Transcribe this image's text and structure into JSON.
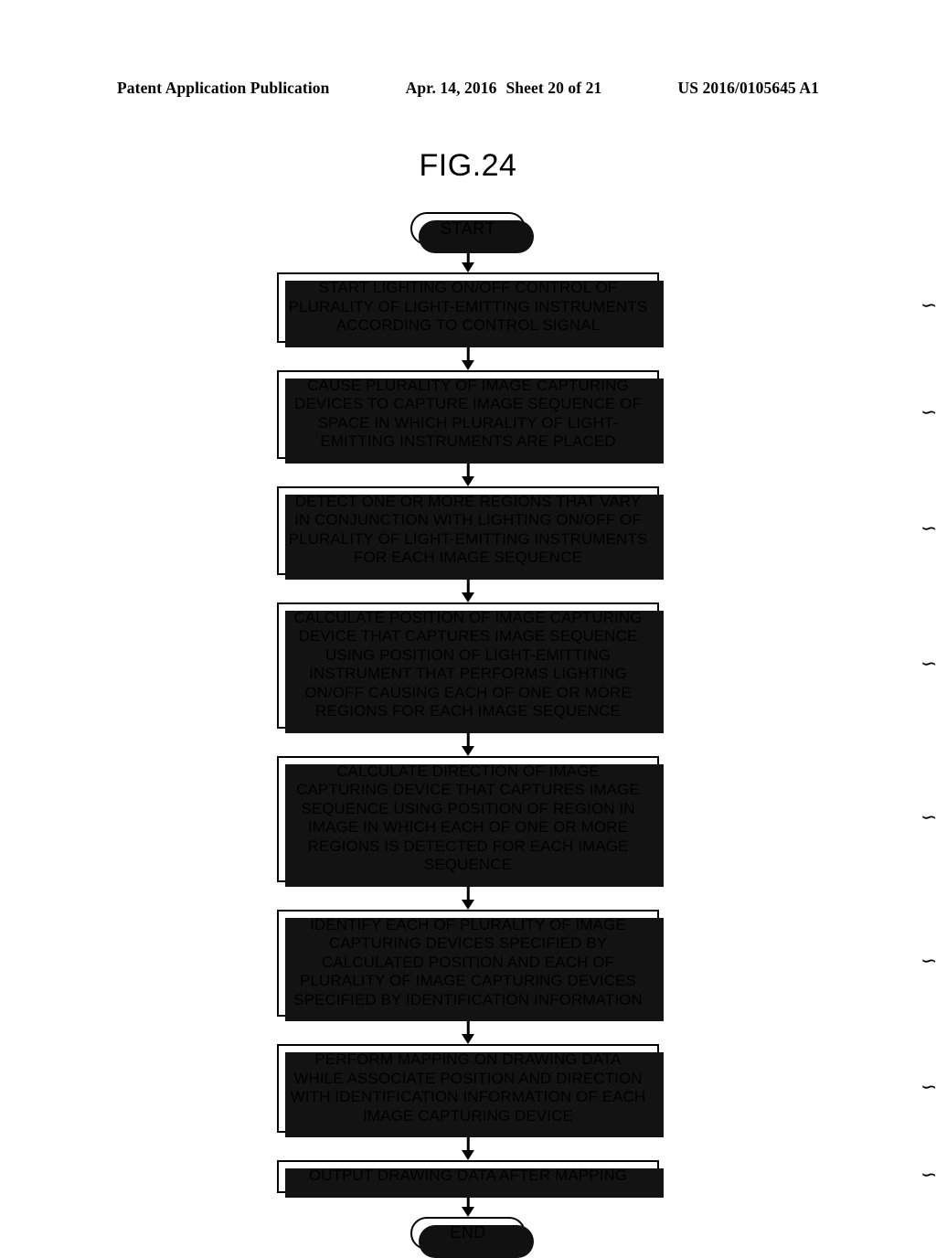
{
  "header": {
    "left": "Patent Application Publication",
    "date": "Apr. 14, 2016",
    "sheet": "Sheet 20 of 21",
    "pubnum": "US 2016/0105645 A1"
  },
  "figure": {
    "title": "FIG.24"
  },
  "flowchart": {
    "start_label": "START",
    "end_label": "END",
    "steps": [
      {
        "id": "S201",
        "lines": [
          "START LIGHTING ON/OFF CONTROL OF",
          "PLURALITY OF LIGHT-EMITTING INSTRUMENTS",
          "ACCORDING TO CONTROL SIGNAL"
        ]
      },
      {
        "id": "S203",
        "lines": [
          "CAUSE PLURALITY OF IMAGE CAPTURING",
          "DEVICES TO CAPTURE IMAGE SEQUENCE OF",
          "SPACE IN WHICH PLURALITY OF LIGHT-",
          "EMITTING INSTRUMENTS ARE PLACED"
        ]
      },
      {
        "id": "S205",
        "lines": [
          "DETECT ONE OR MORE REGIONS THAT VARY",
          "IN CONJUNCTION WITH LIGHTING ON/OFF OF",
          "PLURALITY OF LIGHT-EMITTING INSTRUMENTS",
          "FOR EACH IMAGE SEQUENCE"
        ]
      },
      {
        "id": "S207",
        "lines": [
          "CALCULATE POSITION OF IMAGE CAPTURING",
          "DEVICE THAT CAPTURES IMAGE SEQUENCE",
          "USING POSITION OF LIGHT-EMITTING",
          "INSTRUMENT THAT PERFORMS LIGHTING",
          "ON/OFF CAUSING EACH OF ONE OR MORE",
          "REGIONS FOR EACH IMAGE SEQUENCE"
        ]
      },
      {
        "id": "S208",
        "lines": [
          "CALCULATE DIRECTION OF IMAGE",
          "CAPTURING DEVICE THAT CAPTURES IMAGE",
          "SEQUENCE USING POSITION OF REGION IN",
          "IMAGE IN WHICH EACH OF ONE OR MORE",
          "REGIONS IS DETECTED FOR EACH IMAGE",
          "SEQUENCE"
        ]
      },
      {
        "id": "S209",
        "lines": [
          "IDENTIFY EACH OF PLURALITY OF IMAGE",
          "CAPTURING DEVICES SPECIFIED BY",
          "CALCULATED POSITION AND EACH OF",
          "PLURALITY OF IMAGE CAPTURING DEVICES",
          "SPECIFIED BY IDENTIFICATION INFORMATION"
        ]
      },
      {
        "id": "S211",
        "lines": [
          "PERFORM MAPPING ON DRAWING DATA",
          "WHILE ASSOCIATE POSITION AND DIRECTION",
          "WITH IDENTIFICATION INFORMATION OF EACH",
          "IMAGE CAPTURING DEVICE"
        ]
      },
      {
        "id": "S213",
        "lines": [
          "OUTPUT DRAWING DATA AFTER MAPPING"
        ]
      }
    ]
  },
  "colors": {
    "ink": "#000000",
    "paper": "#ffffff",
    "shadow": "#131313"
  }
}
